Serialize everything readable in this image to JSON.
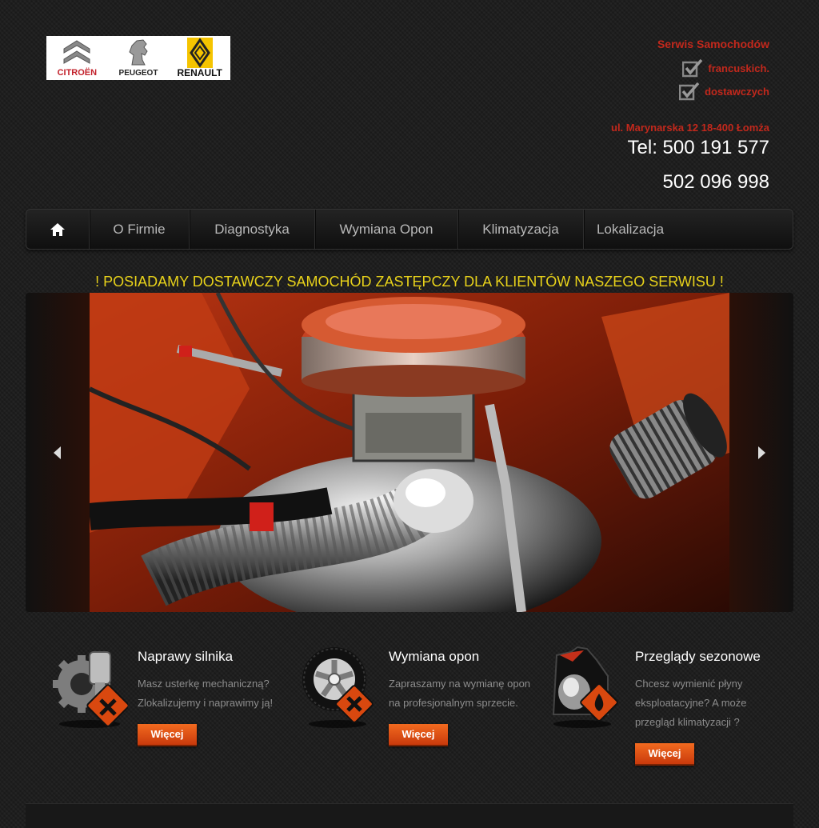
{
  "logo": {
    "brands": [
      "CITROËN",
      "PEUGEOT",
      "RENAULT"
    ]
  },
  "header": {
    "title": "Serwis Samochodów",
    "features": [
      "francuskich.",
      "dostawczych"
    ],
    "address": "ul. Marynarska 12 18-400 Łomża",
    "phone_line1": "Tel: 500 191 577",
    "phone_line2": "502 096 998"
  },
  "nav": {
    "home_icon": "home-icon",
    "items": [
      "O Firmie",
      "Diagnostyka",
      "Wymiana Opon",
      "Klimatyzacja",
      "Lokalizacja"
    ]
  },
  "announcement": "! POSIADAMY DOSTAWCZY SAMOCHÓD ZASTĘPCZY DLA KLIENTÓW NASZEGO SERWISU !",
  "slider": {
    "prev_icon": "arrow-left-icon",
    "next_icon": "arrow-right-icon"
  },
  "features": [
    {
      "icon": "engine-gear-icon",
      "title": "Naprawy silnika",
      "desc_lines": [
        "Masz usterkę mechaniczną?",
        "Zlokalizujemy i naprawimy ją!"
      ],
      "button": "Więcej"
    },
    {
      "icon": "wheel-icon",
      "title": "Wymiana opon",
      "desc_lines": [
        "Zapraszamy na wymianę opon",
        "na profesjonalnym sprzecie."
      ],
      "button": "Więcej"
    },
    {
      "icon": "oil-can-icon",
      "title": "Przeglądy sezonowe",
      "desc_lines": [
        "Chcesz wymienić płyny",
        "eksploatacyjne? A może",
        "przegląd klimatyzacji ?"
      ],
      "button": "Więcej"
    }
  ],
  "colors": {
    "accent_red": "#c2281c",
    "announce_yellow": "#e8d21a",
    "button_orange": "#e85a18"
  }
}
